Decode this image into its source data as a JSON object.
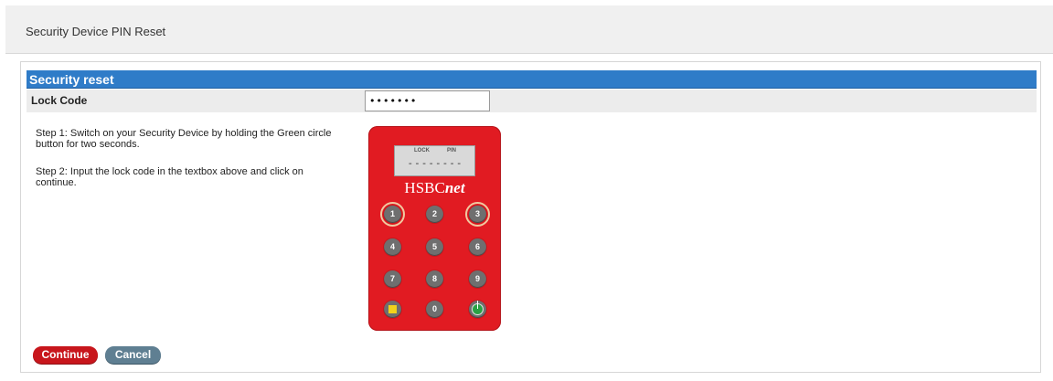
{
  "page": {
    "title": "Security Device PIN Reset"
  },
  "section": {
    "header": "Security reset"
  },
  "lock": {
    "label": "Lock Code",
    "value": "•••••••"
  },
  "steps": {
    "step1": "Step 1: Switch on your Security Device by holding the Green circle button for two seconds.",
    "step2": "Step 2: Input the lock code in the textbox above and click on continue."
  },
  "device": {
    "lcd_lock": "LOCK",
    "lcd_pin": "PIN",
    "lcd_dashes": "--------",
    "brand_main": "HSBC",
    "brand_suffix": "net",
    "keys": [
      "1",
      "2",
      "3",
      "4",
      "5",
      "6",
      "7",
      "8",
      "9",
      "0"
    ],
    "highlighted_keys": [
      "1",
      "3"
    ],
    "colors": {
      "body": "#e11b22",
      "power": "#2aa145",
      "stop": "#f2d21b"
    }
  },
  "buttons": {
    "continue": "Continue",
    "cancel": "Cancel"
  },
  "colors": {
    "header": "#2f7cc8",
    "continue": "#c8161c",
    "cancel": "#5f7f92"
  }
}
